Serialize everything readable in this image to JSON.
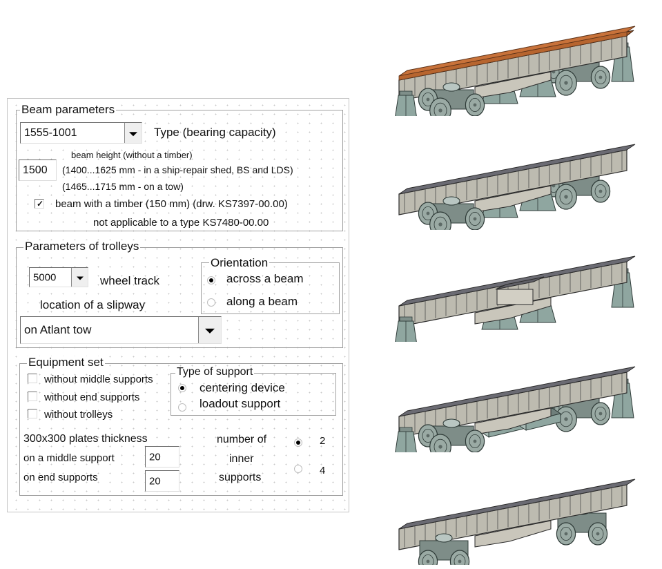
{
  "beam_parameters": {
    "legend": "Beam parameters",
    "type_select_value": "1555-1001",
    "type_label": "Type (bearing capacity)",
    "beam_height_label": "beam height (without a timber)",
    "beam_height_value": "1500",
    "range_shed": "(1400...1625 mm - in a ship-repair shed, BS and LDS)",
    "range_tow": "(1465...1715 mm - on a tow)",
    "timber_checkbox_label": "beam with a timber (150 mm) (drw. KS7397-00.00)",
    "timber_checked": true,
    "timber_note": "not applicable to a type KS7480-00.00"
  },
  "trolley_parameters": {
    "legend": "Parameters of trolleys",
    "wheel_track_value": "5000",
    "wheel_track_label": "wheel track",
    "slipway_label": "location of a slipway",
    "slipway_value": "on Atlant tow",
    "orientation": {
      "legend": "Orientation",
      "options": [
        {
          "label": "across a beam",
          "selected": true
        },
        {
          "label": "along a beam",
          "selected": false
        }
      ]
    }
  },
  "equipment_set": {
    "legend": "Equipment set",
    "checkboxes": [
      {
        "label": "without middle supports",
        "checked": false
      },
      {
        "label": "without end supports",
        "checked": false
      },
      {
        "label": "without trolleys",
        "checked": false
      }
    ],
    "type_of_support": {
      "legend": "Type of support",
      "options": [
        {
          "label": "centering device",
          "selected": true
        },
        {
          "label": "loadout support",
          "selected": false
        }
      ]
    },
    "plates_label": "300x300 plates thickness",
    "middle_support_label": "on a middle support",
    "middle_support_value": "20",
    "end_supports_label": "on end supports",
    "end_supports_value": "20",
    "inner_supports_label": [
      "number of",
      "inner",
      "supports"
    ],
    "inner_supports_options": [
      {
        "label": "2",
        "selected": true
      },
      {
        "label": "4",
        "selected": false
      }
    ]
  },
  "illustrations": [
    {
      "name": "beam-with-timber-on-trolleys",
      "timber": true,
      "trolleys": true,
      "middle": "centering",
      "end_supports": true
    },
    {
      "name": "beam-on-trolleys",
      "timber": false,
      "trolleys": true,
      "middle": "centering",
      "end_supports": false
    },
    {
      "name": "beam-without-trolleys",
      "timber": false,
      "trolleys": false,
      "middle": "centering",
      "end_supports": true
    },
    {
      "name": "beam-with-loadout-supports",
      "timber": false,
      "trolleys": true,
      "middle": "loadout",
      "end_supports": true
    },
    {
      "name": "beam-along-trolleys",
      "timber": false,
      "trolleys": "along",
      "middle": "none",
      "end_supports": false
    }
  ],
  "colors": {
    "timber": "#c8723a",
    "beam_top": "#6b6b73",
    "beam_side": "#bdbbb0",
    "support": "#8fa6a0",
    "trolley": "#9aaaa4"
  }
}
